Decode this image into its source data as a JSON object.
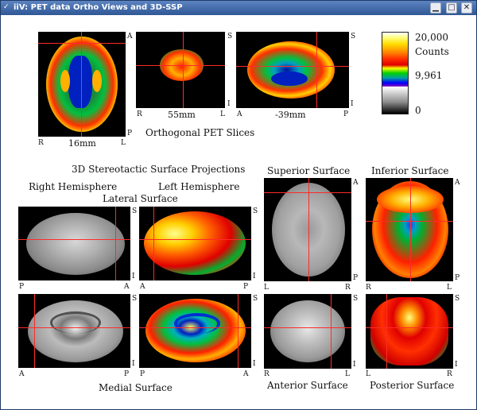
{
  "window": {
    "title": "iiV: PET data Ortho Views and 3D-SSP",
    "app_icon": "v-icon",
    "buttons": {
      "minimize": "▁",
      "maximize": "□",
      "close": "✕"
    }
  },
  "ortho": {
    "heading": "Orthogonal PET Slices",
    "axial": {
      "corner_a": "A",
      "corner_p": "P",
      "left": "R",
      "right": "L",
      "position": "16mm"
    },
    "coronal": {
      "corner_s": "S",
      "corner_i": "I",
      "left": "R",
      "right": "L",
      "position": "55mm"
    },
    "sagittal": {
      "corner_s": "S",
      "corner_i": "I",
      "left": "A",
      "right": "P",
      "position": "-39mm"
    }
  },
  "colorbar": {
    "max": "20,000",
    "units": "Counts",
    "mid": "9,961",
    "min": "0"
  },
  "ssp": {
    "heading": "3D Stereotactic Surface Projections",
    "right_hemisphere": "Right Hemisphere",
    "left_hemisphere": "Left Hemisphere",
    "lateral_surface": "Lateral Surface",
    "medial_surface": "Medial Surface",
    "superior_surface": "Superior Surface",
    "inferior_surface": "Inferior Surface",
    "anterior_surface": "Anterior Surface",
    "posterior_surface": "Posterior Surface",
    "views": {
      "right_lateral": {
        "tr": "S",
        "br": "A",
        "bl": "P",
        "rb": "I"
      },
      "left_lateral": {
        "tr": "S",
        "bl": "A",
        "br": "P",
        "rb": "I"
      },
      "superior": {
        "tr": "A",
        "bl": "L",
        "br": "R",
        "rb": "P"
      },
      "inferior": {
        "tr": "A",
        "bl": "R",
        "br": "L",
        "rb": "P"
      },
      "right_medial": {
        "tr": "S",
        "bl": "A",
        "br": "P",
        "rb": "I"
      },
      "left_medial": {
        "tr": "S",
        "bl": "P",
        "br": "A",
        "rb": "I"
      },
      "anterior": {
        "tr": "S",
        "bl": "R",
        "br": "L",
        "rb": "I"
      },
      "posterior": {
        "tr": "S",
        "bl": "L",
        "br": "R",
        "rb": "I"
      }
    }
  }
}
